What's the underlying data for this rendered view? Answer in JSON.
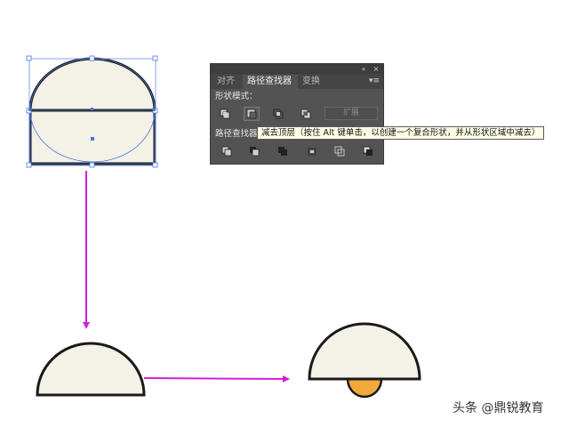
{
  "panel": {
    "tabs": [
      {
        "label": "对齐",
        "active": false
      },
      {
        "label": "路径查找器",
        "active": true
      },
      {
        "label": "变换",
        "active": false
      }
    ],
    "titlebar": {
      "collapse_icon": "«",
      "close_icon": "×"
    },
    "menu_icon": "▾≡",
    "shape_modes_label": "形状模式：",
    "expand_label": "扩展",
    "pathfinders_label": "路径查找器："
  },
  "tooltip": {
    "text": "减去顶层（按住 Alt 键单击，以创建一个复合形状，并从形状区域中减去）"
  },
  "watermark": {
    "text": "头条 @鼎锐教育"
  },
  "colors": {
    "shape_fill": "#f4f1e7",
    "shape_stroke": "#1a1a1a",
    "selection": "#4a78d8",
    "arrow": "#d020d8",
    "bulb": "#f2a93b",
    "panel_bg": "#535353"
  }
}
